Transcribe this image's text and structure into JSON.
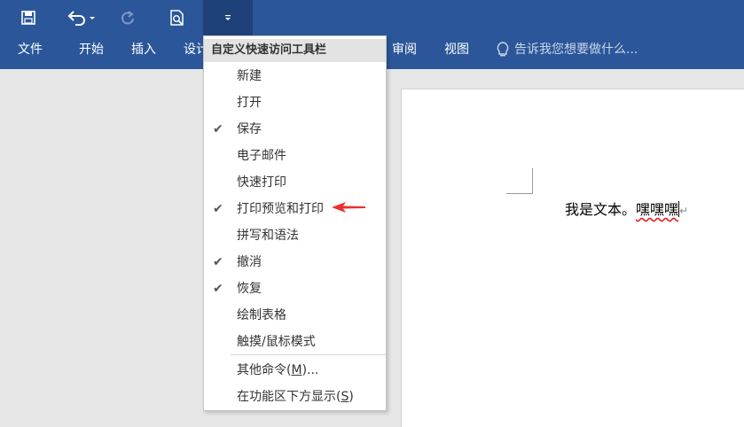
{
  "quick_access": {
    "save": "save-icon",
    "undo": "undo-icon",
    "redo": "redo-icon",
    "print_preview": "print-preview-icon",
    "customize": "customize-qat-icon"
  },
  "ribbon_tabs": [
    {
      "label": "文件"
    },
    {
      "label": "开始"
    },
    {
      "label": "插入"
    },
    {
      "label": "设计"
    },
    {
      "label": "审阅"
    },
    {
      "label": "视图"
    }
  ],
  "tell_me": "告诉我您想要做什么...",
  "menu": {
    "header": "自定义快速访问工具栏",
    "items": [
      {
        "label": "新建",
        "checked": false
      },
      {
        "label": "打开",
        "checked": false
      },
      {
        "label": "保存",
        "checked": true
      },
      {
        "label": "电子邮件",
        "checked": false
      },
      {
        "label": "快速打印",
        "checked": false
      },
      {
        "label": "打印预览和打印",
        "checked": true
      },
      {
        "label": "拼写和语法",
        "checked": false
      },
      {
        "label": "撤消",
        "checked": true
      },
      {
        "label": "恢复",
        "checked": true
      },
      {
        "label": "绘制表格",
        "checked": false
      },
      {
        "label": "触摸/鼠标模式",
        "checked": false
      }
    ],
    "more_commands": {
      "text": "其他命令(",
      "key": "M",
      "tail": ")..."
    },
    "show_below": {
      "text": "在功能区下方显示(",
      "key": "S",
      "tail": ")"
    }
  },
  "document": {
    "text_main": "我是文本。",
    "text_misspelled": "嘿嘿嘿"
  },
  "colors": {
    "ribbon": "#2b579a",
    "highlight_arrow": "#e8312a"
  }
}
